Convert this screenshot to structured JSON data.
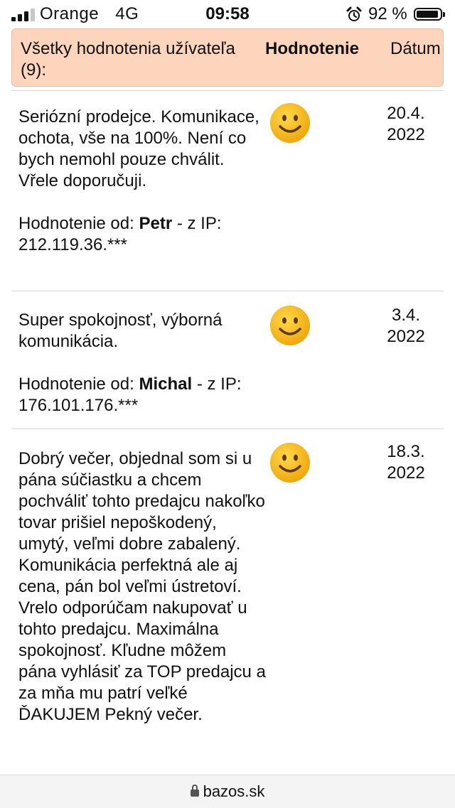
{
  "status_bar": {
    "carrier": "Orange",
    "network": "4G",
    "time": "09:58",
    "battery": "92 %",
    "signal_bars_filled": 3,
    "signal_bars_total": 4,
    "battery_level": 0.92
  },
  "header": {
    "all_ratings": "Všetky hodnotenia užívateľa (9):",
    "rating": "Hodnotenie",
    "date": "Dátum"
  },
  "reviews": [
    {
      "text": "Seriózní prodejce. Komunikace, ochota, vše na 100%. Není co bych nemohl pouze chválit. Vřele doporučuji.",
      "author_prefix": "Hodnotenie od:",
      "author": "Petr",
      "ip_text": " - z IP: 212.119.36.***",
      "date_line1": "20.4.",
      "date_line2": "2022",
      "rating_icon": "smile-icon"
    },
    {
      "text": "Super spokojnosť, výborná komunikácia.",
      "author_prefix": "Hodnotenie od:",
      "author": "Michal",
      "ip_text": " - z IP: 176.101.176.***",
      "date_line1": "3.4.",
      "date_line2": "2022",
      "rating_icon": "smile-icon"
    },
    {
      "text": "Dobrý večer, objednal som si u pána súčiastku a chcem pochváliť tohto predajcu nakoľko tovar prišiel nepoškodený, umytý, veľmi dobre zabalený. Komunikácia perfektná ale aj cena, pán bol veľmi ústretoví. Vrelo odporúčam nakupovať u tohto predajcu. Maximálna spokojnosť. Kľudne môžem pána vyhlásiť za TOP predajcu a za mňa mu patrí veľké ĎAKUJEM Pekný večer.",
      "date_line1": "18.3.",
      "date_line2": "2022",
      "rating_icon": "smile-icon"
    }
  ],
  "url_bar": {
    "domain": "bazos.sk"
  },
  "colors": {
    "header_bg": "#fdd5bd",
    "smile_face": "#f7b51c",
    "divider": "#d6d6d6"
  }
}
